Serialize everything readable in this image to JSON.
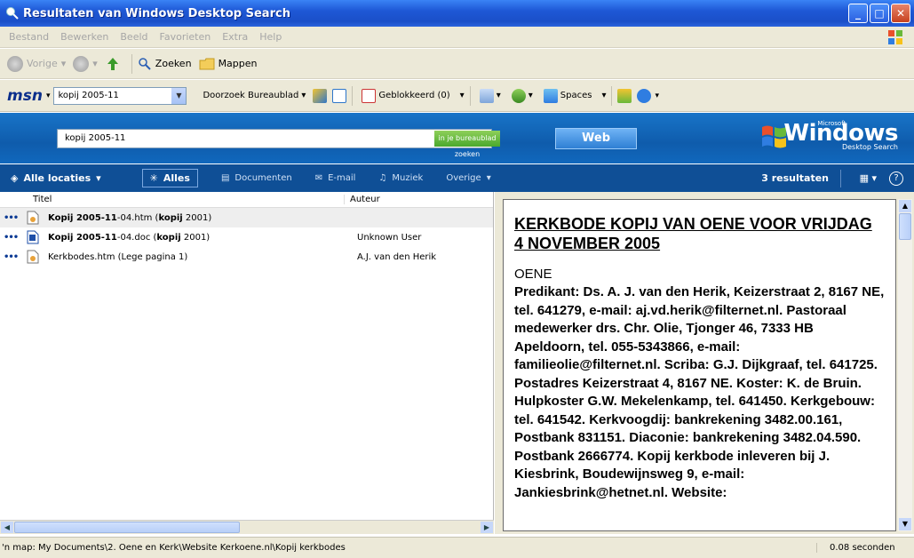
{
  "window": {
    "title": "Resultaten van Windows Desktop Search"
  },
  "menu": {
    "items": [
      "Bestand",
      "Bewerken",
      "Beeld",
      "Favorieten",
      "Extra",
      "Help"
    ]
  },
  "nav": {
    "back": "Vorige",
    "search": "Zoeken",
    "folders": "Mappen"
  },
  "msn": {
    "logo": "msn",
    "query_combo": "kopij 2005-11",
    "scope": "Doorzoek Bureaublad",
    "blocked": "Geblokkeerd (0)",
    "spaces": "Spaces"
  },
  "search": {
    "query": "kopij 2005-11",
    "desktop_button": "in je bureaublad zoeken",
    "web_button": "Web",
    "brand_ms": "Microsoft",
    "brand_win": "Windows",
    "brand_ds": "Desktop Search"
  },
  "filters": {
    "location": "Alle locaties",
    "all": "Alles",
    "documents": "Documenten",
    "email": "E-mail",
    "music": "Muziek",
    "other": "Overige",
    "results": "3 resultaten"
  },
  "list": {
    "col_title": "Titel",
    "col_author": "Auteur",
    "rows": [
      {
        "dots": "•••",
        "prefix": "Kopij 2005-11",
        "mid": "-04.htm (",
        "bold": "kopij",
        "suffix": " 2001)",
        "author": ""
      },
      {
        "dots": "•••",
        "prefix": "Kopij 2005-11",
        "mid": "-04.doc (",
        "bold": "kopij",
        "suffix": " 2001)",
        "author": "Unknown User"
      },
      {
        "dots": "•••",
        "prefix": "",
        "mid": "Kerkbodes.htm (Lege pagina 1)",
        "bold": "",
        "suffix": "",
        "author": "A.J. van den Herik"
      }
    ]
  },
  "preview": {
    "heading": "KERKBODE KOPIJ VAN OENE VOOR VRIJDAG  4 NOVEMBER 2005",
    "section": "OENE",
    "body": "Predikant: Ds. A. J. van den Herik, Keizerstraat 2, 8167 NE, tel. 641279, e-mail: aj.vd.herik@filternet.nl. Pastoraal medewerker drs. Chr. Olie, Tjonger 46, 7333 HB Apeldoorn, tel. 055-5343866, e-mail: familieolie@filternet.nl. Scriba: G.J. Dijkgraaf, tel. 641725. Postadres Keizerstraat 4, 8167 NE. Koster: K. de Bruin. Hulpkoster G.W. Mekelenkamp, tel. 641450. Kerkgebouw: tel. 641542. Kerkvoogdij: bankrekening 3482.00.161, Postbank 831151. Diaconie: bankrekening 3482.04.590. Postbank 2666774. Kopij kerkbode inleveren bij J. Kiesbrink, Boudewijnsweg 9, e-mail: Jankiesbrink@hetnet.nl. Website:"
  },
  "status": {
    "path": "'n map:  My Documents\\2. Oene en Kerk\\Website Kerkoene.nl\\Kopij kerkbodes",
    "time": "0.08 seconden"
  },
  "colors": {
    "titlebar": "#1e58d6",
    "searchhead": "#0f5cac",
    "filterbar": "#0f4f96",
    "chrome": "#ece9d8"
  }
}
